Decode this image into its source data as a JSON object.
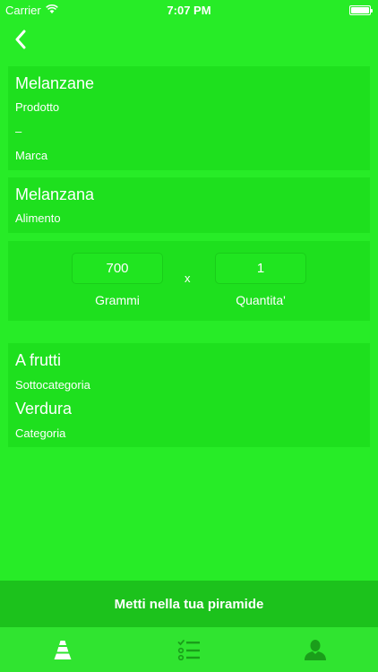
{
  "status_bar": {
    "carrier": "Carrier",
    "time": "7:07 PM"
  },
  "product_card": {
    "product_name": "Melanzane",
    "product_label": "Prodotto",
    "brand_value": "–",
    "brand_label": "Marca"
  },
  "food_card": {
    "food_name": "Melanzana",
    "food_label": "Alimento"
  },
  "quantity_card": {
    "grams_value": "700",
    "grams_label": "Grammi",
    "multiply": "x",
    "quantity_value": "1",
    "quantity_label": "Quantita'"
  },
  "category_card": {
    "subcategory_value": "A frutti",
    "subcategory_label": "Sottocategoria",
    "category_value": "Verdura",
    "category_label": "Categoria"
  },
  "cta": {
    "label": "Metti nella tua piramide"
  },
  "tabs": [
    {
      "icon": "pyramid-icon",
      "selected": true
    },
    {
      "icon": "checklist-icon",
      "selected": false
    },
    {
      "icon": "person-icon",
      "selected": false
    }
  ],
  "colors": {
    "background": "#27ec27",
    "card": "#1ee01e",
    "cta": "#1cc21c",
    "tab_selected": "#ffffff",
    "tab_unselected": "#1a9e1a"
  }
}
